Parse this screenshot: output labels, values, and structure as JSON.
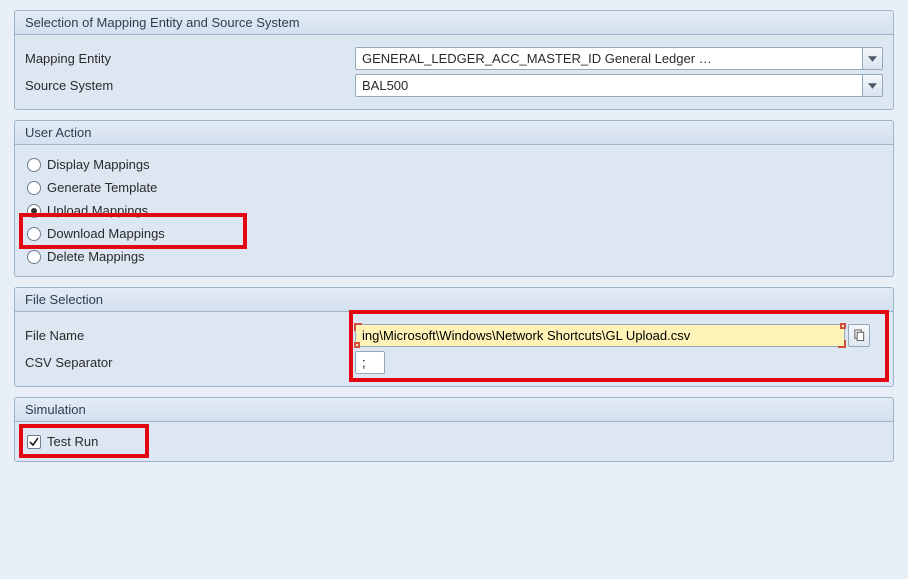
{
  "group_selection": {
    "title": "Selection of Mapping Entity and Source System",
    "mapping_entity_label": "Mapping Entity",
    "mapping_entity_value": "GENERAL_LEDGER_ACC_MASTER_ID General Ledger …",
    "source_system_label": "Source System",
    "source_system_value": "BAL500"
  },
  "group_user_action": {
    "title": "User Action",
    "options": {
      "display": "Display Mappings",
      "generate": "Generate Template",
      "upload": "Upload Mappings",
      "download": "Download Mappings",
      "delete": "Delete Mappings"
    },
    "selected": "upload"
  },
  "group_file_selection": {
    "title": "File Selection",
    "file_name_label": "File Name",
    "file_name_value": "ing\\Microsoft\\Windows\\Network Shortcuts\\GL Upload.csv",
    "csv_separator_label": "CSV Separator",
    "csv_separator_value": ";"
  },
  "group_simulation": {
    "title": "Simulation",
    "test_run_label": "Test Run",
    "test_run_checked": true
  }
}
